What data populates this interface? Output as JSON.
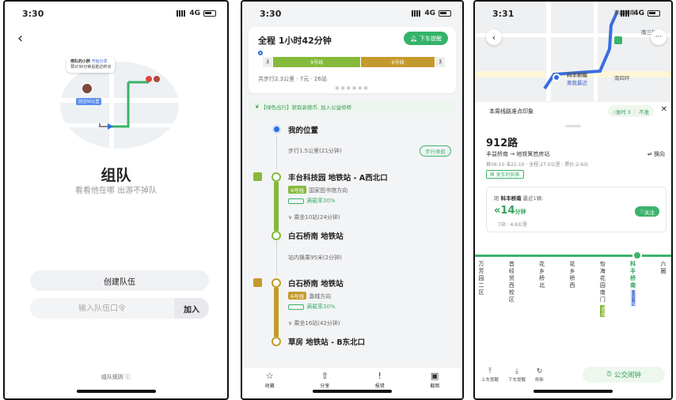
{
  "screen1": {
    "time": "3:30",
    "network": "4G",
    "bubble_name": "排队的小胖",
    "bubble_sub": "预计30分钟后抵达终点",
    "bubble_link": "开始分享",
    "map_tag": "前往50公里",
    "title": "组队",
    "subtitle": "看看他在哪  出游不掉队",
    "create_label": "创建队伍",
    "join_placeholder": "输入队伍口令",
    "join_label": "加入",
    "rules_label": "组队规则"
  },
  "screen2": {
    "time": "3:30",
    "network": "4G",
    "trip_title": "全程  1小时42分钟",
    "remind_label": "下车提醒",
    "seg_line9": "9号线",
    "seg_line6": "6号线",
    "trip_meta": "共步行2.3公里 · 7元 · 26站",
    "banner": "【绿色出行】获取高德币, 加入公益修桥",
    "my_location": "我的位置",
    "walk1": "步行1.5公里(21分钟)",
    "walk_nav": "步行导航",
    "station1": "丰台科技园 地铁站 - A西北口",
    "line9_tag": "9号线",
    "line9_dir": "国家图书馆方向",
    "crowd1": "满载率30%",
    "ride1": "乘坐10站(24分钟)",
    "station2": "白石桥南 地铁站",
    "transfer": "站内换乘95米(2分钟)",
    "station3": "白石桥南 地铁站",
    "line6_tag": "6号线",
    "line6_dir": "潞城方向",
    "crowd2": "满载率30%",
    "ride2": "乘坐16站(42分钟)",
    "station4": "草房 地铁站 - B东北口",
    "tabs": [
      {
        "icon": "☆",
        "label": "收藏"
      },
      {
        "icon": "⇧",
        "label": "分享"
      },
      {
        "icon": "!",
        "label": "报错"
      },
      {
        "icon": "▣",
        "label": "截图"
      }
    ],
    "colors": {
      "line9": "#85b93b",
      "line6": "#c59a2c",
      "green": "#35b36a"
    }
  },
  "screen3": {
    "time": "3:31",
    "network": "4G",
    "map_labels": {
      "station_top": "丰益桥南",
      "road_right": "南三环",
      "road_fourth": "南四环",
      "station_map": "科丰桥南",
      "nearest": "离我最近"
    },
    "survey_title": "本周线路准点印象",
    "survey_yes": "准时 3",
    "survey_no": "不准",
    "route_no": "912路",
    "direction": "丰益桥南 → 地铁篱笆房站",
    "swap_label": "换向",
    "hours": "首06:10 末21:10 · 全程:27.0公里 · 票价:2-6元",
    "timetable": "发车时刻表",
    "next_head_pre": "距",
    "next_head_station": "科丰桥南",
    "next_head_post": "最近1辆:",
    "next_minutes": "14",
    "next_unit": "分钟",
    "next_dist": "7站 · 4.6公里",
    "follow_label": "关注",
    "stops": [
      {
        "name": "万芳园二区"
      },
      {
        "name": "首经贸西校区"
      },
      {
        "name": "花乡桥北"
      },
      {
        "name": "花乡桥西"
      },
      {
        "name": "怡海花园南门",
        "metro": "9号线"
      },
      {
        "name": "科丰桥南",
        "current": true,
        "nearest": "离我最近"
      },
      {
        "name": "六圈"
      }
    ],
    "bottom": [
      {
        "icon": "⤒",
        "label": "上车提醒"
      },
      {
        "icon": "⤓",
        "label": "下车提醒"
      },
      {
        "icon": "↻",
        "label": "刷新"
      }
    ],
    "alarm_label": "公交闹钟"
  }
}
